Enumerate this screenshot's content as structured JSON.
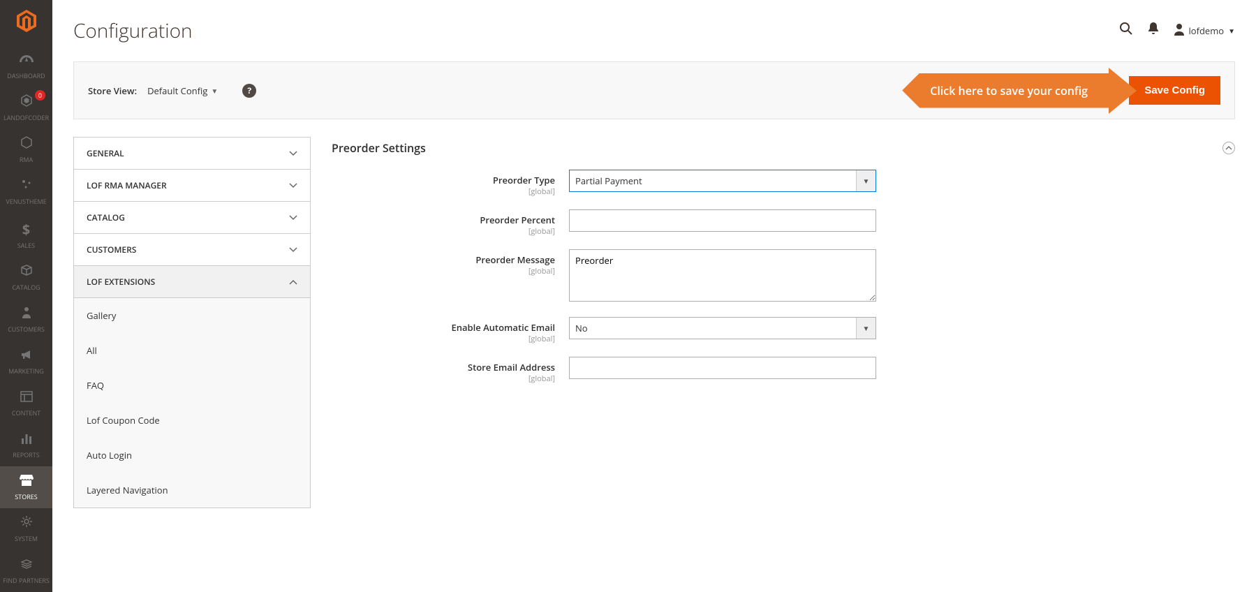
{
  "sidebar": {
    "logo_alt": "Magento",
    "items": [
      {
        "name": "dashboard",
        "label": "DASHBOARD",
        "icon": "speedometer",
        "badge": null
      },
      {
        "name": "landofcoder",
        "label": "LANDOFCODER",
        "icon": "hexagon",
        "badge": "0"
      },
      {
        "name": "rma",
        "label": "RMA",
        "icon": "hexagon-outline",
        "badge": null
      },
      {
        "name": "venustheme",
        "label": "VENUSTHEME",
        "icon": "sparkle",
        "badge": null
      },
      {
        "name": "sales",
        "label": "SALES",
        "icon": "dollar",
        "badge": null
      },
      {
        "name": "catalog",
        "label": "CATALOG",
        "icon": "box",
        "badge": null
      },
      {
        "name": "customers",
        "label": "CUSTOMERS",
        "icon": "person",
        "badge": null
      },
      {
        "name": "marketing",
        "label": "MARKETING",
        "icon": "megaphone",
        "badge": null
      },
      {
        "name": "content",
        "label": "CONTENT",
        "icon": "layout",
        "badge": null
      },
      {
        "name": "reports",
        "label": "REPORTS",
        "icon": "bars",
        "badge": null
      },
      {
        "name": "stores",
        "label": "STORES",
        "icon": "storefront",
        "badge": null,
        "active": true
      },
      {
        "name": "system",
        "label": "SYSTEM",
        "icon": "gear",
        "badge": null
      },
      {
        "name": "find-partners",
        "label": "FIND PARTNERS",
        "icon": "partners",
        "badge": null
      }
    ]
  },
  "header": {
    "title": "Configuration",
    "user": "lofdemo"
  },
  "action_bar": {
    "store_view_label": "Store View:",
    "store_view_value": "Default Config",
    "callout": "Click here to save your config",
    "save_button": "Save Config"
  },
  "config_tabs": [
    {
      "label": "GENERAL",
      "expanded": false
    },
    {
      "label": "LOF RMA MANAGER",
      "expanded": false
    },
    {
      "label": "CATALOG",
      "expanded": false
    },
    {
      "label": "CUSTOMERS",
      "expanded": false
    },
    {
      "label": "LOF EXTENSIONS",
      "expanded": true,
      "items": [
        "Gallery",
        "All",
        "FAQ",
        "Lof Coupon Code",
        "Auto Login",
        "Layered Navigation"
      ]
    }
  ],
  "panel": {
    "title": "Preorder Settings",
    "scope_label": "[global]",
    "fields": {
      "preorder_type": {
        "label": "Preorder Type",
        "value": "Partial Payment"
      },
      "preorder_percent": {
        "label": "Preorder Percent",
        "value": ""
      },
      "preorder_message": {
        "label": "Preorder Message",
        "value": "Preorder"
      },
      "enable_auto_email": {
        "label": "Enable Automatic Email",
        "value": "No"
      },
      "store_email": {
        "label": "Store Email Address",
        "value": ""
      }
    }
  }
}
